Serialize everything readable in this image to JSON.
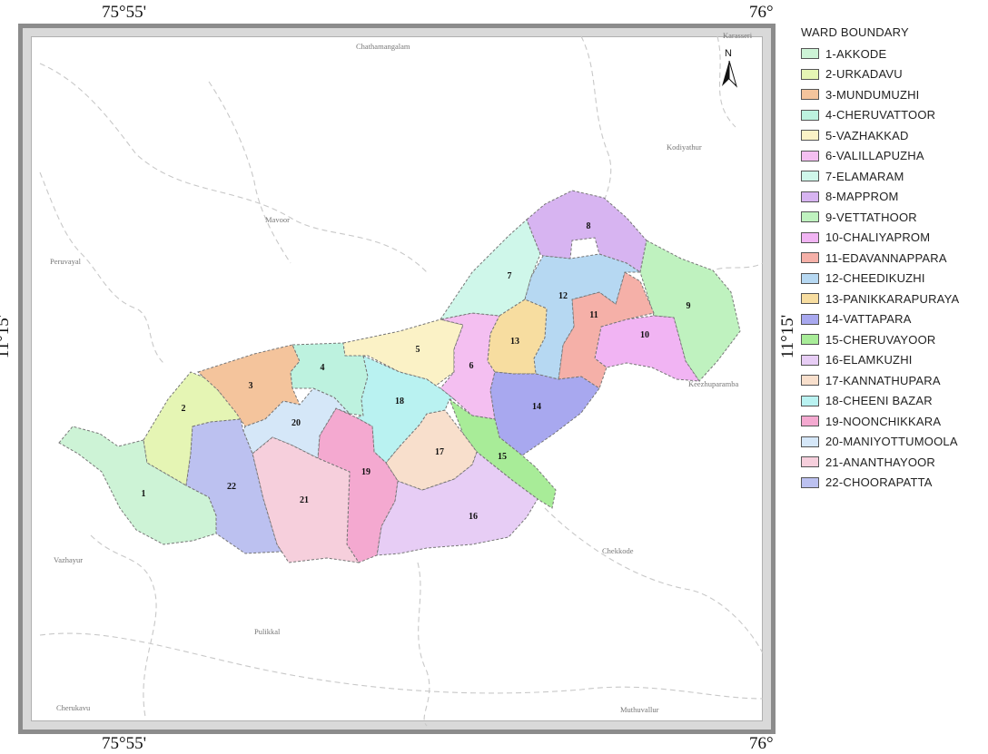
{
  "coordinates": {
    "top_left": "75°55'",
    "top_right": "76°",
    "bottom_left": "75°55'",
    "bottom_right": "76°",
    "left_lat": "11°15'",
    "right_lat": "11°15'"
  },
  "north_arrow": {
    "label": "N",
    "icon": "north-arrow-icon"
  },
  "places": [
    "Chathamangalam",
    "Karasseri",
    "Kodiyathur",
    "Mavoor",
    "Peruvayal",
    "Keezhuparamba",
    "Chekkode",
    "Vazhayur",
    "Pulikkal",
    "Cherukavu",
    "Muthuvallur"
  ],
  "legend": {
    "title": "WARD BOUNDARY",
    "items": [
      {
        "label": "1-AKKODE",
        "color": "#cdf3d6"
      },
      {
        "label": "2-URKADAVU",
        "color": "#e5f5b4"
      },
      {
        "label": "3-MUNDUMUZHI",
        "color": "#f4c49c"
      },
      {
        "label": "4-CHERUVATTOOR",
        "color": "#bdf2df"
      },
      {
        "label": "5-VAZHAKKAD",
        "color": "#fbf2c6"
      },
      {
        "label": "6-VALILLAPUZHA",
        "color": "#f4bff1"
      },
      {
        "label": "7-ELAMARAM",
        "color": "#cff7ea"
      },
      {
        "label": "8-MAPPROM",
        "color": "#d7b4f1"
      },
      {
        "label": "9-VETTATHOOR",
        "color": "#bff2bf"
      },
      {
        "label": "10-CHALIYAPROM",
        "color": "#f1b4f3"
      },
      {
        "label": "11-EDAVANNAPPARA",
        "color": "#f5b0a8"
      },
      {
        "label": "12-CHEEDIKUZHI",
        "color": "#b6d8f2"
      },
      {
        "label": "13-PANIKKARAPURAYA",
        "color": "#f7dda0"
      },
      {
        "label": "14-VATTAPARA",
        "color": "#a8a8ef"
      },
      {
        "label": "15-CHERUVAYOOR",
        "color": "#a8ec98"
      },
      {
        "label": "16-ELAMKUZHI",
        "color": "#e7cdf5"
      },
      {
        "label": "17-KANNATHUPARA",
        "color": "#f8dfcc"
      },
      {
        "label": "18-CHEENI BAZAR",
        "color": "#b9f2f1"
      },
      {
        "label": "19-NOONCHIKKARA",
        "color": "#f4a9d0"
      },
      {
        "label": "20-MANIYOTTUMOOLA",
        "color": "#d5e7f8"
      },
      {
        "label": "21-ANANTHAYOOR",
        "color": "#f6cfdc"
      },
      {
        "label": "22-CHOORAPATTA",
        "color": "#bcc1f0"
      }
    ]
  },
  "wards": [
    "1",
    "2",
    "3",
    "4",
    "5",
    "6",
    "7",
    "8",
    "9",
    "10",
    "11",
    "12",
    "13",
    "14",
    "15",
    "16",
    "17",
    "18",
    "19",
    "20",
    "21",
    "22"
  ]
}
